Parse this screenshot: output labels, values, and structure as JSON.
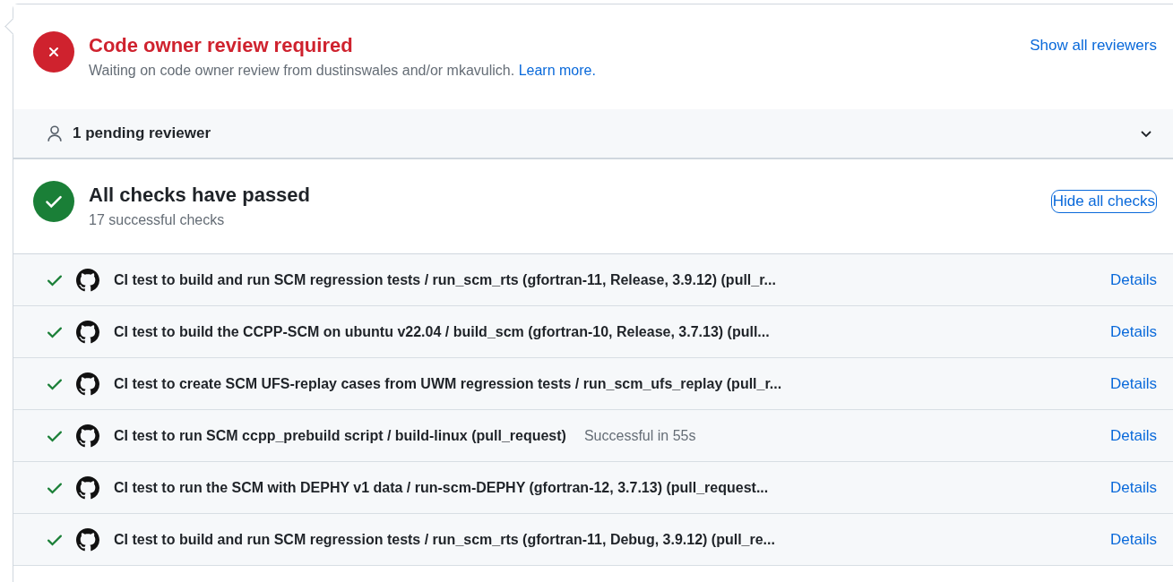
{
  "review": {
    "passed": false,
    "title": "Code owner review required",
    "description": "Waiting on code owner review from dustinswales and/or mkavulich.",
    "link": "Learn more.",
    "action": "Show all reviewers"
  },
  "reviewers": {
    "label": "1 pending reviewer",
    "expanded": false
  },
  "checks_summary": {
    "passed": true,
    "title": "All checks have passed",
    "subtitle": "17 successful checks",
    "action": "Hide all checks"
  },
  "checks": [
    {
      "passed": true,
      "name": "CI test to build and run SCM regression tests / run_scm_rts (gfortran-11, Release, 3.9.12) (pull_r...",
      "link": "Details"
    },
    {
      "passed": true,
      "name": "CI test to build the CCPP-SCM on ubuntu v22.04 / build_scm (gfortran-10, Release, 3.7.13) (pull...",
      "link": "Details"
    },
    {
      "passed": true,
      "name": "CI test to create SCM UFS-replay cases from UWM regression tests / run_scm_ufs_replay (pull_r...",
      "link": "Details"
    },
    {
      "passed": true,
      "name": "CI test to run SCM ccpp_prebuild script / build-linux (pull_request)",
      "duration": "Successful in 55s",
      "link": "Details"
    },
    {
      "passed": true,
      "name": "CI test to run the SCM with DEPHY v1 data / run-scm-DEPHY (gfortran-12, 3.7.13) (pull_request...",
      "link": "Details"
    },
    {
      "passed": true,
      "name": "CI test to build and run SCM regression tests / run_scm_rts (gfortran-11, Debug, 3.9.12) (pull_re...",
      "link": "Details"
    }
  ]
}
